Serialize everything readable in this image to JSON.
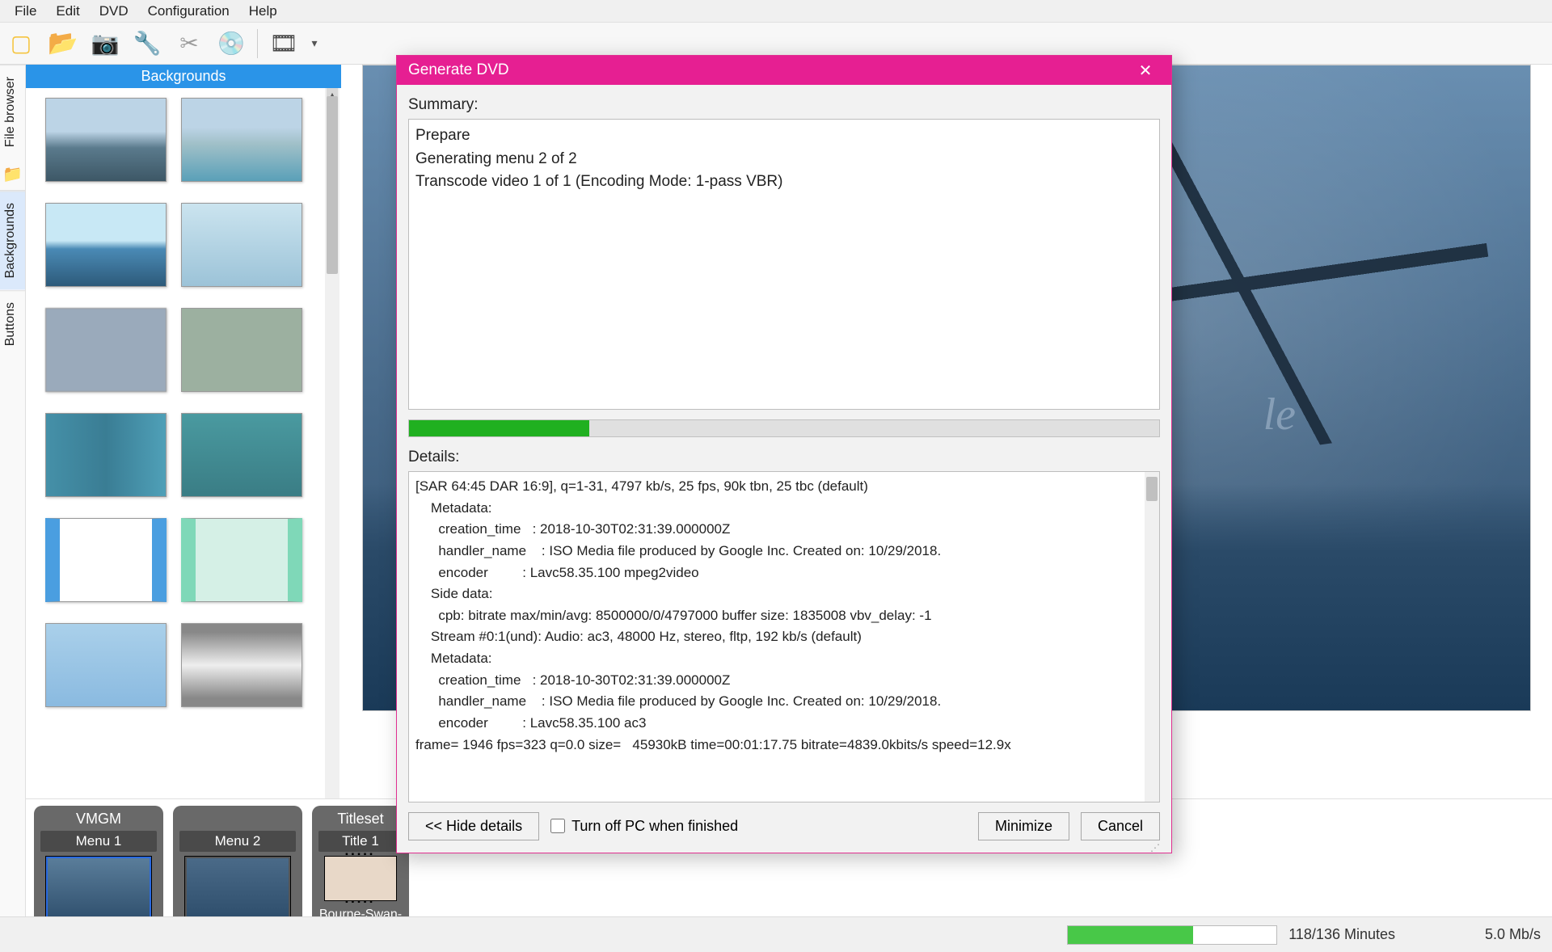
{
  "menubar": [
    "File",
    "Edit",
    "DVD",
    "Configuration",
    "Help"
  ],
  "browser": {
    "header": "Backgrounds"
  },
  "sidetabs": {
    "t1": "File browser",
    "t2": "Backgrounds",
    "t3": "Buttons"
  },
  "preview_title": "le",
  "strip": {
    "vmgm": "VMGM",
    "menu1": "Menu 1",
    "menu2": "Menu 2",
    "titleset": "Titleset",
    "title1": "Title 1",
    "clip": "Bourne-Swan-Lake"
  },
  "modal": {
    "title": "Generate DVD",
    "summary_label": "Summary:",
    "summary_lines": [
      "Prepare",
      "Generating menu 2 of 2",
      "Transcode video 1 of 1 (Encoding Mode: 1-pass VBR)"
    ],
    "progress_pct": 24,
    "details_label": "Details:",
    "details_text": "[SAR 64:45 DAR 16:9], q=1-31, 4797 kb/s, 25 fps, 90k tbn, 25 tbc (default)\n    Metadata:\n      creation_time   : 2018-10-30T02:31:39.000000Z\n      handler_name    : ISO Media file produced by Google Inc. Created on: 10/29/2018.\n      encoder         : Lavc58.35.100 mpeg2video\n    Side data:\n      cpb: bitrate max/min/avg: 8500000/0/4797000 buffer size: 1835008 vbv_delay: -1\n    Stream #0:1(und): Audio: ac3, 48000 Hz, stereo, fltp, 192 kb/s (default)\n    Metadata:\n      creation_time   : 2018-10-30T02:31:39.000000Z\n      handler_name    : ISO Media file produced by Google Inc. Created on: 10/29/2018.\n      encoder         : Lavc58.35.100 ac3\nframe= 1946 fps=323 q=0.0 size=   45930kB time=00:01:17.75 bitrate=4839.0kbits/s speed=12.9x",
    "hide": "<< Hide details",
    "shutdown": "Turn off PC when finished",
    "minimize": "Minimize",
    "cancel": "Cancel"
  },
  "status": {
    "minutes": "118/136 Minutes",
    "rate": "5.0 Mb/s",
    "pct": 60
  }
}
